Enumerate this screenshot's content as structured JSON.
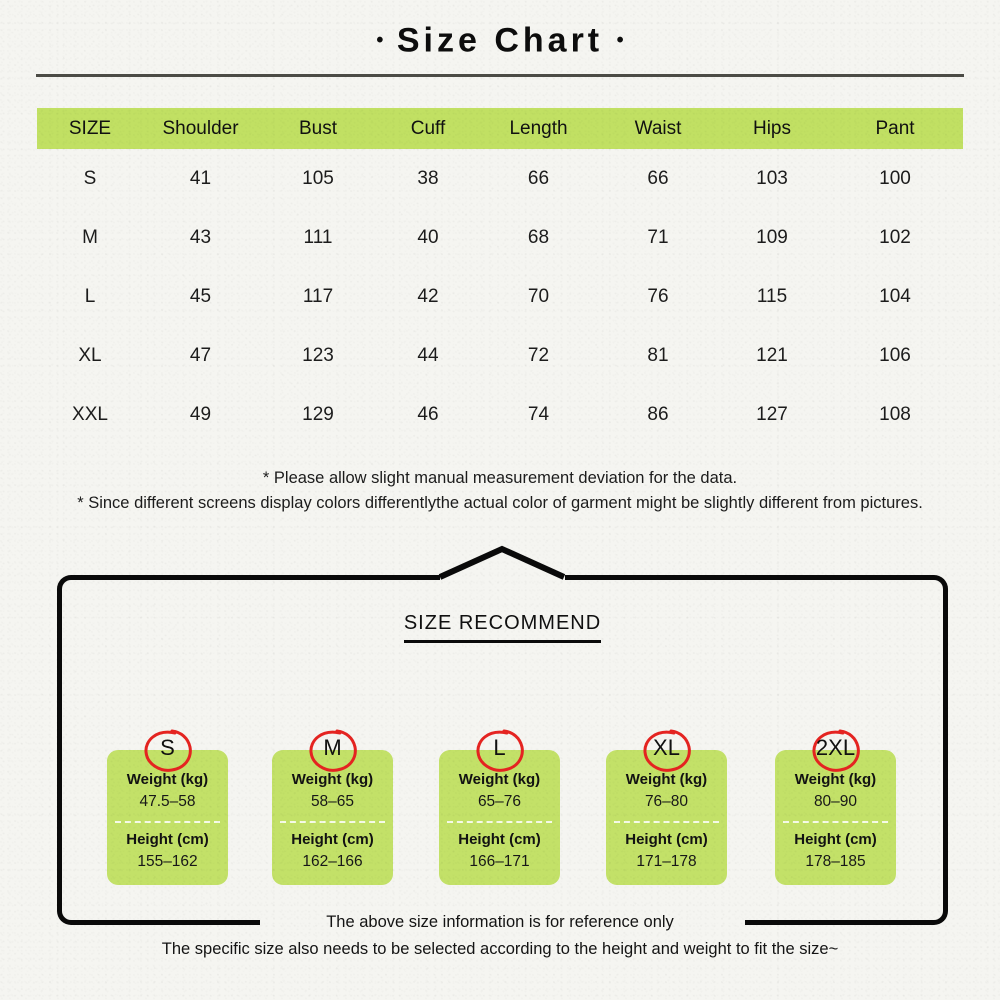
{
  "title": {
    "left_dot": "•",
    "text": "Size Chart",
    "right_dot": "•"
  },
  "colors": {
    "accent_green": "#c1e063",
    "card_green": "#c3e168",
    "badge_red": "#e52421",
    "rule_gray": "#4b4b45",
    "background": "#f5f5f1",
    "frame_black": "#0a0a0a"
  },
  "table": {
    "headers": [
      "SIZE",
      "Shoulder",
      "Bust",
      "Cuff",
      "Length",
      "Waist",
      "Hips",
      "Pant"
    ],
    "rows": [
      [
        "S",
        "41",
        "105",
        "38",
        "66",
        "66",
        "103",
        "100"
      ],
      [
        "M",
        "43",
        "111",
        "40",
        "68",
        "71",
        "109",
        "102"
      ],
      [
        "L",
        "45",
        "117",
        "42",
        "70",
        "76",
        "115",
        "104"
      ],
      [
        "XL",
        "47",
        "123",
        "44",
        "72",
        "81",
        "121",
        "106"
      ],
      [
        "XXL",
        "49",
        "129",
        "46",
        "74",
        "86",
        "127",
        "108"
      ]
    ]
  },
  "notes": [
    "* Please allow slight manual measurement deviation for the data.",
    "* Since different screens display colors differentlythe actual color of garment might be slightly different from pictures."
  ],
  "recommend": {
    "heading": "SIZE RECOMMEND",
    "weight_label": "Weight (kg)",
    "height_label": "Height (cm)",
    "cards": [
      {
        "size": "S",
        "weight": "47.5–58",
        "height": "155–162"
      },
      {
        "size": "M",
        "weight": "58–65",
        "height": "162–166"
      },
      {
        "size": "L",
        "weight": "65–76",
        "height": "166–171"
      },
      {
        "size": "XL",
        "weight": "76–80",
        "height": "171–178"
      },
      {
        "size": "2XL",
        "weight": "80–90",
        "height": "178–185"
      }
    ]
  },
  "footer": [
    "The above size information is for reference only",
    "The specific size also needs to be selected according to the height and weight to fit the size~"
  ]
}
